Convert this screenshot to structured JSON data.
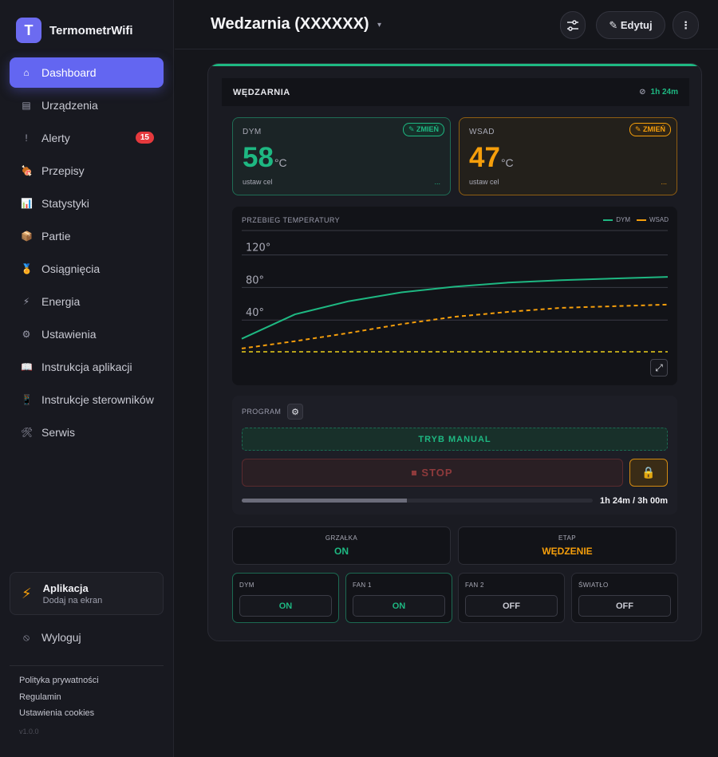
{
  "app": {
    "logo_letter": "T",
    "name": "TermometrWifi"
  },
  "nav": [
    {
      "icon": "⌂",
      "label": "Dashboard"
    },
    {
      "icon": "▤",
      "label": "Urządzenia"
    },
    {
      "icon": "!",
      "label": "Alerty",
      "badge": "15"
    },
    {
      "icon": "🍖",
      "label": "Przepisy"
    },
    {
      "icon": "📊",
      "label": "Statystyki"
    },
    {
      "icon": "📦",
      "label": "Partie"
    },
    {
      "icon": "🏅",
      "label": "Osiągnięcia"
    },
    {
      "icon": "⚡",
      "label": "Energia"
    },
    {
      "icon": "⚙",
      "label": "Ustawienia"
    },
    {
      "icon": "📖",
      "label": "Instrukcja aplikacji"
    },
    {
      "icon": "📱",
      "label": "Instrukcje sterowników"
    },
    {
      "icon": "🛠",
      "label": "Serwis"
    }
  ],
  "install_card": {
    "icon": "⚡",
    "title": "Aplikacja",
    "subtitle": "Dodaj na ekran"
  },
  "logout": {
    "icon": "⦸",
    "label": "Wyloguj"
  },
  "footer": {
    "privacy": "Polityka prywatności",
    "terms": "Regulamin",
    "cookies": "Ustawienia cookies",
    "version": "v1.0.0"
  },
  "header": {
    "title": "Wedzarnia (XXXXXX)",
    "caret": "▾",
    "sliders_icon": "⚙",
    "edit_label": "✎ Edytuj",
    "more_icon": "⋮"
  },
  "device": {
    "name": "WĘDZARNIA",
    "offline_icon": "⊘",
    "runtime": "1h 24m",
    "smoke": {
      "label": "DYM",
      "change": "✎ ZMIEŃ",
      "value": "58",
      "unit": "°C",
      "target_label": "ustaw cel",
      "target_value": "..."
    },
    "product": {
      "label": "WSAD",
      "change": "✎ ZMIEŃ",
      "value": "47",
      "unit": "°C",
      "target_label": "ustaw cel",
      "target_value": "..."
    }
  },
  "chart_data": {
    "type": "line",
    "title": "PRZEBIEG TEMPERATURY",
    "ylim": [
      0,
      150
    ],
    "yticks": [
      {
        "value": 120,
        "label": "120°"
      },
      {
        "value": 80,
        "label": "80°"
      },
      {
        "value": 40,
        "label": "40°"
      }
    ],
    "legend_position": "top-right",
    "grid": true,
    "x": [
      0,
      1,
      2,
      3,
      4,
      5,
      6,
      7,
      8
    ],
    "series": [
      {
        "name": "DYM",
        "color": "#1eb882",
        "style": "solid",
        "values": [
          17,
          47,
          63,
          74,
          81,
          86,
          89,
          91,
          93
        ]
      },
      {
        "name": "WSAD",
        "color": "#f59e0b",
        "style": "dashed",
        "values": [
          5,
          14,
          24,
          35,
          44,
          50,
          55,
          57,
          59
        ]
      },
      {
        "name": "",
        "color": "#b7a11a",
        "style": "dashed",
        "values": [
          1,
          1,
          1,
          1,
          1,
          1,
          1,
          1,
          1
        ]
      }
    ]
  },
  "chart_expand_icon": "⤢",
  "program": {
    "label": "PROGRAM",
    "gear_icon": "⚙",
    "mode": "TRYB MANUAL",
    "stop_label": "STOP",
    "lock_icon": "🔒",
    "progress": 0.47,
    "progress_text": "1h 24m / 3h 00m"
  },
  "status": {
    "heater": {
      "label": "GRZAŁKA",
      "value": "ON"
    },
    "stage": {
      "label": "ETAP",
      "value": "WĘDZENIE"
    }
  },
  "switches": [
    {
      "label": "DYM",
      "value": "ON",
      "state": "on"
    },
    {
      "label": "FAN 1",
      "value": "ON",
      "state": "on"
    },
    {
      "label": "FAN 2",
      "value": "OFF",
      "state": "off"
    },
    {
      "label": "ŚWIATŁO",
      "value": "OFF",
      "state": "off"
    }
  ],
  "colors": {
    "accent": "#6366f1",
    "green": "#1eb882",
    "orange": "#f59e0b",
    "danger": "#e5393d"
  }
}
